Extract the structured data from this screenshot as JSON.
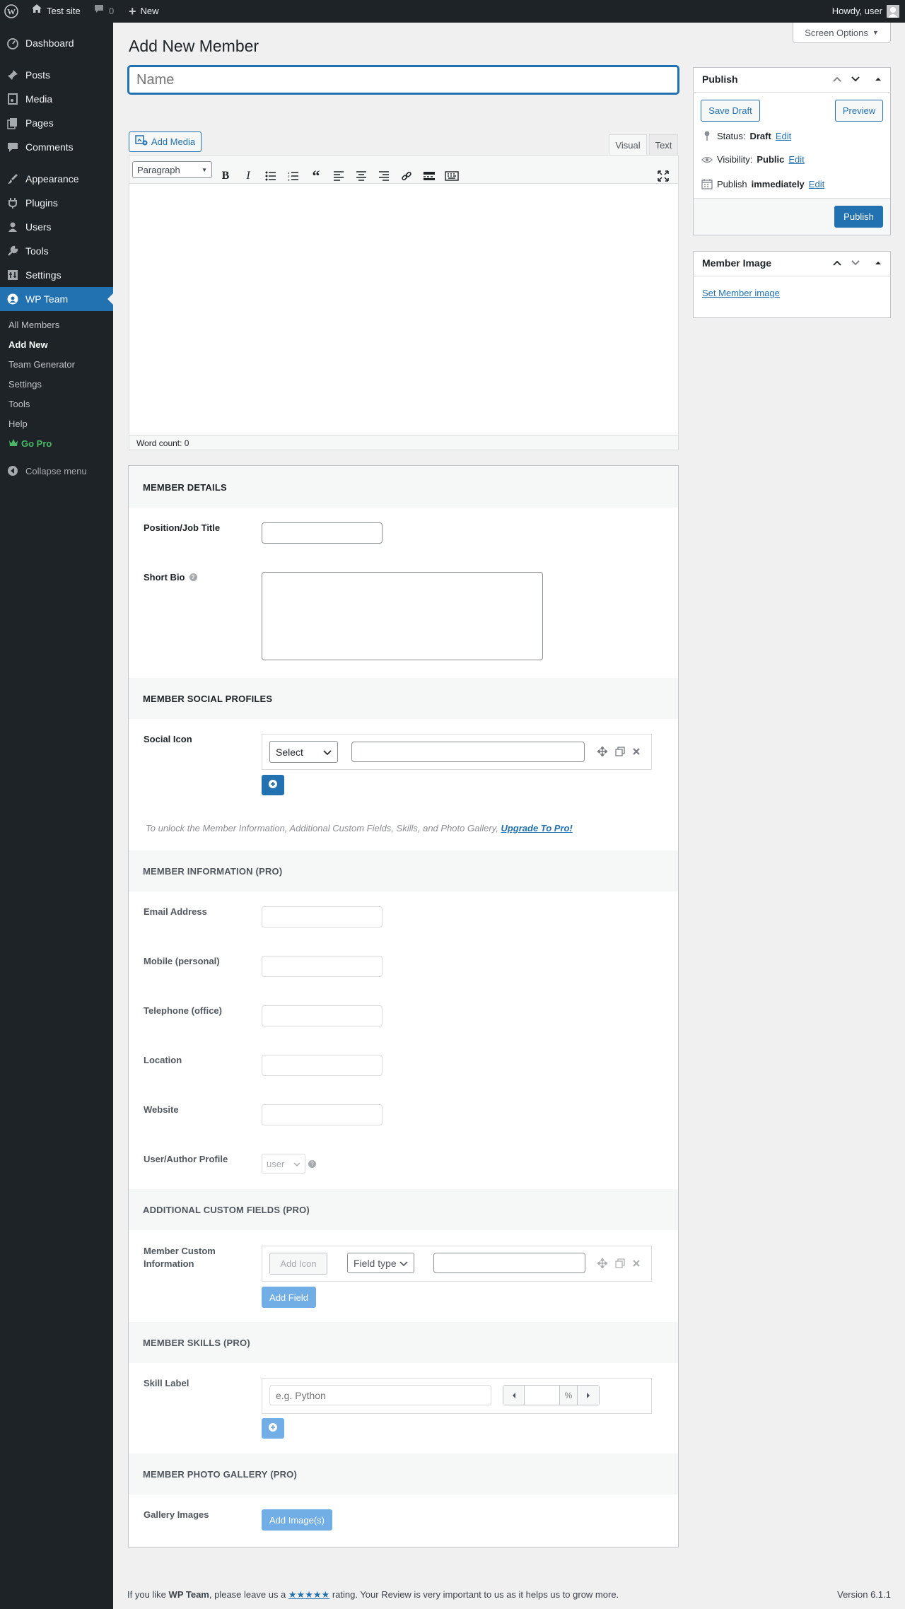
{
  "adminbar": {
    "site_name": "Test site",
    "comments_count": "0",
    "new_label": "New",
    "howdy": "Howdy, user"
  },
  "sidebar": {
    "items": [
      {
        "label": "Dashboard",
        "icon": "dashboard-icon"
      },
      {
        "label": "Posts",
        "icon": "pin-icon"
      },
      {
        "label": "Media",
        "icon": "media-icon"
      },
      {
        "label": "Pages",
        "icon": "pages-icon"
      },
      {
        "label": "Comments",
        "icon": "comment-icon"
      },
      {
        "label": "Appearance",
        "icon": "brush-icon"
      },
      {
        "label": "Plugins",
        "icon": "plugin-icon"
      },
      {
        "label": "Users",
        "icon": "users-icon"
      },
      {
        "label": "Tools",
        "icon": "wrench-icon"
      },
      {
        "label": "Settings",
        "icon": "settings-icon"
      },
      {
        "label": "WP Team",
        "icon": "team-icon"
      }
    ],
    "submenu": [
      "All Members",
      "Add New",
      "Team Generator",
      "Settings",
      "Tools",
      "Help",
      "Go Pro"
    ],
    "collapse": "Collapse menu"
  },
  "screen_options": "Screen Options",
  "page_title": "Add New Member",
  "title_placeholder": "Name",
  "editor": {
    "add_media": "Add Media",
    "tab_visual": "Visual",
    "tab_text": "Text",
    "format": "Paragraph",
    "word_count": "Word count: 0"
  },
  "publish": {
    "title": "Publish",
    "save_draft": "Save Draft",
    "preview": "Preview",
    "status_label": "Status:",
    "status_value": "Draft",
    "visibility_label": "Visibility:",
    "visibility_value": "Public",
    "publish_label": "Publish",
    "publish_value": "immediately",
    "edit": "Edit",
    "publish_button": "Publish"
  },
  "member_image": {
    "title": "Member Image",
    "link": "Set Member image"
  },
  "details": {
    "heading": "MEMBER DETAILS",
    "position_label": "Position/Job Title",
    "bio_label": "Short Bio"
  },
  "social": {
    "heading": "MEMBER SOCIAL PROFILES",
    "label": "Social Icon",
    "select": "Select",
    "upgrade_text": "To unlock the Member Information, Additional Custom Fields, Skills, and Photo Gallery,",
    "upgrade_link": "Upgrade To Pro!"
  },
  "info": {
    "heading": "MEMBER INFORMATION (PRO)",
    "fields": [
      "Email Address",
      "Mobile (personal)",
      "Telephone (office)",
      "Location",
      "Website",
      "User/Author Profile"
    ],
    "user_select": "user"
  },
  "custom": {
    "heading": "ADDITIONAL CUSTOM FIELDS (PRO)",
    "label_line1": "Member Custom",
    "label_line2": "Information",
    "add_icon": "Add Icon",
    "field_type": "Field type",
    "add_field": "Add Field"
  },
  "skills": {
    "heading": "MEMBER SKILLS (PRO)",
    "label": "Skill Label",
    "placeholder": "e.g. Python",
    "percent": "%"
  },
  "gallery": {
    "heading": "MEMBER PHOTO GALLERY (PRO)",
    "label": "Gallery Images",
    "button": "Add Image(s)"
  },
  "footer": {
    "text_pre": "If you like",
    "plugin": "WP Team",
    "text_mid": ", please leave us a",
    "stars": "★★★★★",
    "text_post": "rating. Your Review is very important to us as it helps us to grow more.",
    "version": "Version 6.1.1"
  }
}
